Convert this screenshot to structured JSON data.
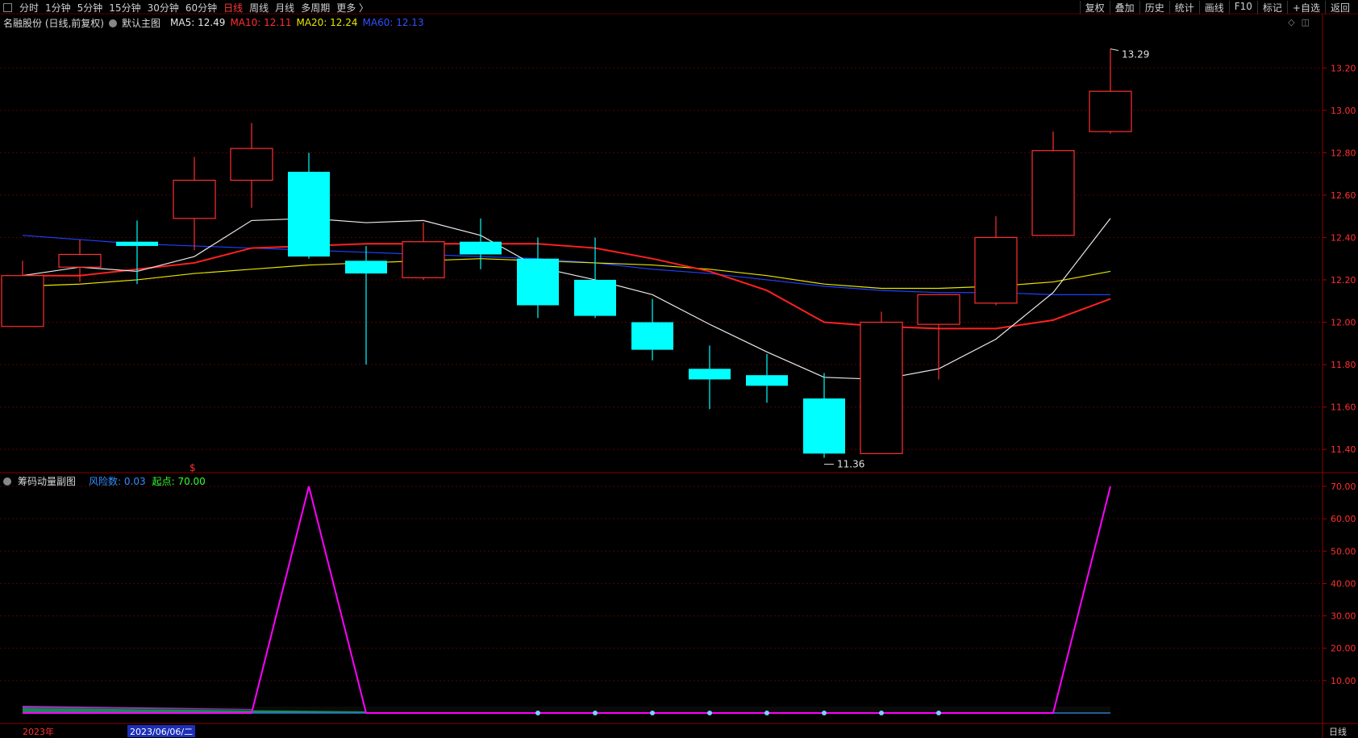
{
  "toolbar": {
    "periods": [
      "分时",
      "1分钟",
      "5分钟",
      "15分钟",
      "30分钟",
      "60分钟",
      "日线",
      "周线",
      "月线",
      "多周期",
      "更多 〉"
    ],
    "active_period": "日线",
    "tools": [
      "复权",
      "叠加",
      "历史",
      "统计",
      "画线",
      "F10",
      "标记",
      "+自选",
      "返回"
    ]
  },
  "main_legend": {
    "stock": "名融股份 (日线,前复权)",
    "template": "默认主图",
    "ma5": "MA5: 12.49",
    "ma10": "MA10: 12.11",
    "ma20": "MA20: 12.24",
    "ma60": "MA60: 12.13"
  },
  "sub_legend": {
    "indicator": "筹码动量副图",
    "risk": "风险数: 0.03",
    "start": "起点: 70.00"
  },
  "markers": {
    "high": "13.29",
    "low": "11.36",
    "dollar": "$"
  },
  "bottom": {
    "year": "2023年",
    "date": "2023/06/06/二",
    "period": "日线"
  },
  "colors": {
    "up": "#ff3030",
    "down": "#00ffff",
    "ma5": "#e8e8e8",
    "ma10": "#ff2020",
    "ma20": "#e6e600",
    "ma60": "#2040ff",
    "momentum": "#ff00ff",
    "axis": "#ff3030",
    "grid": "#5a0000"
  },
  "chart_data": [
    {
      "type": "candlestick",
      "title": "名融股份 (日线,前复权)",
      "ylim": [
        11.29,
        13.38
      ],
      "yticks": [
        "13.20",
        "13.00",
        "12.80",
        "12.60",
        "12.40",
        "12.20",
        "12.00",
        "11.80",
        "11.60",
        "11.40"
      ],
      "candles": [
        {
          "o": 11.98,
          "h": 12.29,
          "l": 11.98,
          "c": 12.22
        },
        {
          "o": 12.26,
          "h": 12.39,
          "l": 12.19,
          "c": 12.32
        },
        {
          "o": 12.38,
          "h": 12.48,
          "l": 12.18,
          "c": 12.36
        },
        {
          "o": 12.49,
          "h": 12.78,
          "l": 12.34,
          "c": 12.67
        },
        {
          "o": 12.67,
          "h": 12.94,
          "l": 12.54,
          "c": 12.82
        },
        {
          "o": 12.71,
          "h": 12.8,
          "l": 12.3,
          "c": 12.31
        },
        {
          "o": 12.29,
          "h": 12.36,
          "l": 11.8,
          "c": 12.23
        },
        {
          "o": 12.21,
          "h": 12.47,
          "l": 12.2,
          "c": 12.38
        },
        {
          "o": 12.38,
          "h": 12.49,
          "l": 12.25,
          "c": 12.32
        },
        {
          "o": 12.3,
          "h": 12.4,
          "l": 12.02,
          "c": 12.08
        },
        {
          "o": 12.2,
          "h": 12.4,
          "l": 12.02,
          "c": 12.03
        },
        {
          "o": 12.0,
          "h": 12.11,
          "l": 11.82,
          "c": 11.87
        },
        {
          "o": 11.78,
          "h": 11.89,
          "l": 11.59,
          "c": 11.73
        },
        {
          "o": 11.75,
          "h": 11.85,
          "l": 11.62,
          "c": 11.7
        },
        {
          "o": 11.64,
          "h": 11.76,
          "l": 11.36,
          "c": 11.38
        },
        {
          "o": 11.38,
          "h": 12.05,
          "l": 11.38,
          "c": 12.0
        },
        {
          "o": 11.99,
          "h": 12.13,
          "l": 11.73,
          "c": 12.13
        },
        {
          "o": 12.09,
          "h": 12.5,
          "l": 12.08,
          "c": 12.4
        },
        {
          "o": 12.41,
          "h": 12.9,
          "l": 12.41,
          "c": 12.81
        },
        {
          "o": 12.9,
          "h": 13.29,
          "l": 12.89,
          "c": 13.09
        }
      ],
      "ma5": [
        12.22,
        12.26,
        12.24,
        12.31,
        12.48,
        12.49,
        12.47,
        12.48,
        12.41,
        12.26,
        12.2,
        12.13,
        11.99,
        11.86,
        11.74,
        11.73,
        11.78,
        11.92,
        12.14,
        12.49
      ],
      "ma10": [
        12.22,
        12.22,
        12.25,
        12.28,
        12.35,
        12.36,
        12.37,
        12.37,
        12.37,
        12.37,
        12.35,
        12.3,
        12.24,
        12.15,
        12.0,
        11.98,
        11.97,
        11.97,
        12.01,
        12.11
      ],
      "ma20": [
        12.17,
        12.18,
        12.2,
        12.23,
        12.25,
        12.27,
        12.28,
        12.29,
        12.3,
        12.29,
        12.28,
        12.27,
        12.25,
        12.22,
        12.18,
        12.16,
        12.16,
        12.17,
        12.19,
        12.24
      ],
      "ma60": [
        12.41,
        12.39,
        12.37,
        12.36,
        12.35,
        12.34,
        12.33,
        12.32,
        12.31,
        12.3,
        12.28,
        12.25,
        12.23,
        12.2,
        12.17,
        12.15,
        12.14,
        12.14,
        12.13,
        12.13
      ]
    },
    {
      "type": "line",
      "title": "筹码动量副图",
      "ylim": [
        -2,
        72
      ],
      "yticks": [
        "70.00",
        "60.00",
        "50.00",
        "40.00",
        "30.00",
        "20.00",
        "10.00"
      ],
      "series": [
        {
          "name": "起点",
          "values": [
            0,
            0,
            0,
            0,
            0,
            70,
            0,
            0,
            0,
            0,
            0,
            0,
            0,
            0,
            0,
            0,
            0,
            0,
            0,
            70
          ]
        }
      ]
    }
  ]
}
